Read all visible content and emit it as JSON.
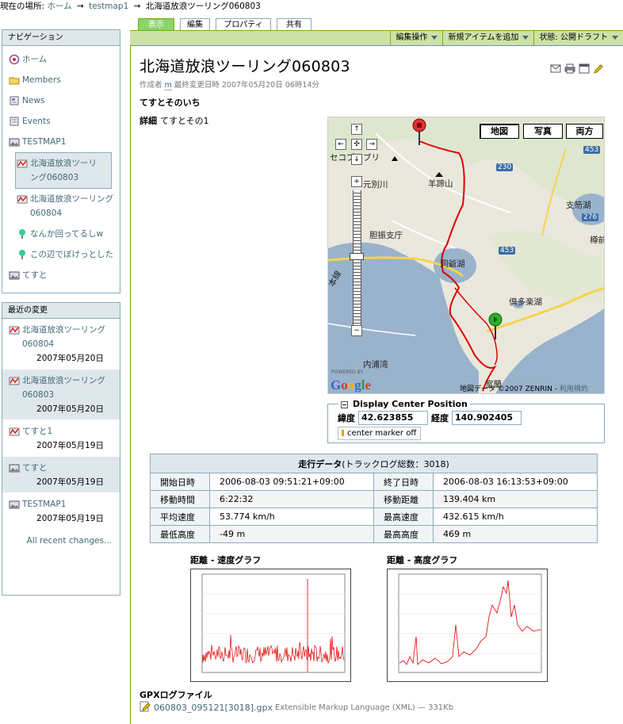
{
  "breadcrumb": {
    "prefix": "現在の場所:",
    "items": [
      "ホーム",
      "testmap1",
      "北海道放浪ツーリング060803"
    ]
  },
  "nav": {
    "header": "ナビゲーション",
    "items": [
      {
        "label": "ホーム",
        "icon": "home-icon"
      },
      {
        "label": "Members",
        "icon": "folder-icon"
      },
      {
        "label": "News",
        "icon": "news-icon"
      },
      {
        "label": "Events",
        "icon": "events-icon"
      },
      {
        "label": "TESTMAP1",
        "icon": "map-icon"
      },
      {
        "label": "北海道放浪ツーリング060803",
        "icon": "track-icon"
      },
      {
        "label": "北海道放浪ツーリング060804",
        "icon": "track-icon"
      },
      {
        "label": "なんか回ってるしw",
        "icon": "pin-icon"
      },
      {
        "label": "この辺でぼけっとした",
        "icon": "pin-icon"
      },
      {
        "label": "てすと",
        "icon": "map-icon"
      }
    ]
  },
  "recent": {
    "header": "最近の変更",
    "items": [
      {
        "label": "北海道放浪ツーリング060804",
        "date": "2007年05月20日"
      },
      {
        "label": "北海道放浪ツーリング060803",
        "date": "2007年05月20日"
      },
      {
        "label": "てすと1",
        "date": "2007年05月19日"
      },
      {
        "label": "てすと",
        "date": "2007年05月19日"
      },
      {
        "label": "TESTMAP1",
        "date": "2007年05月19日"
      }
    ],
    "all_link": "All recent changes..."
  },
  "tabs": [
    "表示",
    "編集",
    "プロパティ",
    "共有"
  ],
  "actions": [
    "編集操作",
    "新規アイテムを追加",
    "状態: 公開ドラフト"
  ],
  "document": {
    "title": "北海道放浪ツーリング060803",
    "byline_prefix": "作成者",
    "author": "m",
    "byline_suffix": "最終変更日時 2007年05月20日 06時14分",
    "description": "てすとそのいち",
    "detail_label": "詳細",
    "detail_text": "てすとその1"
  },
  "map": {
    "buttons": [
      "地図",
      "写真",
      "両方"
    ],
    "labels": {
      "place1": "セコブナブリ",
      "place2": "羊蹄山",
      "place3": "胆振支庁",
      "place4": "洞爺湖",
      "place5": "倶多楽湖",
      "place6": "内浦湾",
      "place7": "支笏湖",
      "place8": "樽前",
      "place9": "元別川",
      "place10": "室蘭",
      "place11": "本線",
      "route453a": "453",
      "route453b": "453",
      "route230": "230",
      "route276": "276"
    },
    "powered": "POWERED BY",
    "google": "Google",
    "copyright": "地図データ ©2007 ZENRIN -",
    "terms": "利用規約"
  },
  "center_position": {
    "legend": "Display Center Position",
    "lat_label": "緯度",
    "lat_value": "42.623855",
    "lng_label": "経度",
    "lng_value": "140.902405",
    "marker_button": "center marker off"
  },
  "stats": {
    "title": "走行データ",
    "count": "(トラックログ総数：3018)",
    "rows": [
      {
        "k1": "開始日時",
        "v1": "2006-08-03 09:51:21+09:00",
        "k2": "終了日時",
        "v2": "2006-08-03 16:13:53+09:00"
      },
      {
        "k1": "移動時間",
        "v1": "6:22:32",
        "k2": "移動距離",
        "v2": "139.404 km"
      },
      {
        "k1": "平均速度",
        "v1": "53.774 km/h",
        "k2": "最高速度",
        "v2": "432.615 km/h"
      },
      {
        "k1": "最低高度",
        "v1": "-49 m",
        "k2": "最高高度",
        "v2": "469 m"
      }
    ]
  },
  "graphs": {
    "speed_title": "距離 - 速度グラフ",
    "alt_title": "距離 - 高度グラフ"
  },
  "gpx": {
    "heading": "GPXログファイル",
    "file": "060803_095121[3018].gpx",
    "meta": "Extensible Markup Language (XML) — 331Kb"
  }
}
